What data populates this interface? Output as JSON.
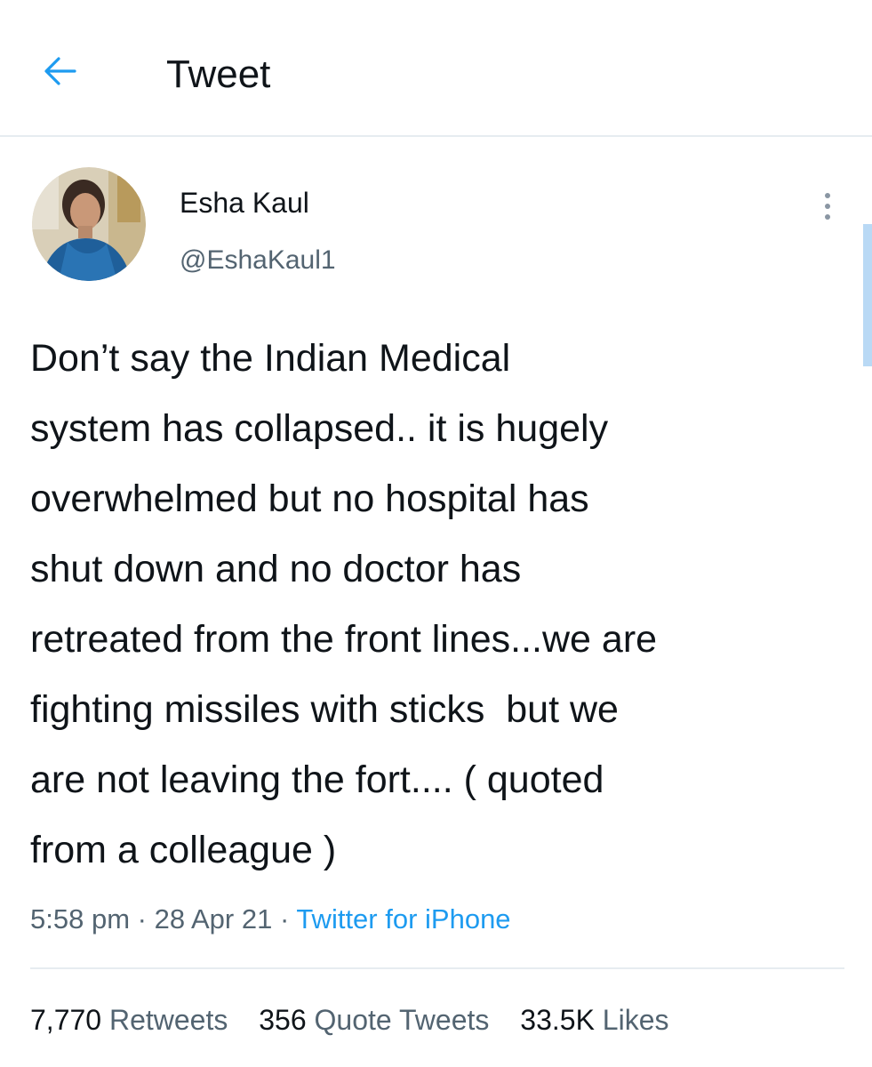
{
  "header": {
    "title": "Tweet",
    "back_icon": "arrow-left-icon",
    "accent_color": "#1d9bf0"
  },
  "author": {
    "display_name": "Esha Kaul",
    "handle": "@EshaKaul1",
    "avatar_icon": "profile-photo-avatar",
    "more_icon": "more-vertical-icon"
  },
  "tweet": {
    "lines": [
      "Don’t say the Indian Medical",
      "system has collapsed.. it is hugely",
      "overwhelmed but no hospital has",
      "shut down and no doctor has",
      "retreated from the front lines...we are",
      "fighting missiles with sticks  but we",
      "are not leaving the fort.... ( quoted",
      "from a colleague )"
    ]
  },
  "meta": {
    "time": "5:58 pm",
    "date": "28 Apr 21",
    "separator": "·",
    "source": "Twitter for iPhone"
  },
  "stats": {
    "retweets_count": "7,770",
    "retweets_label": "Retweets",
    "quotes_count": "356",
    "quotes_label": "Quote Tweets",
    "likes_count": "33.5K",
    "likes_label": "Likes"
  }
}
